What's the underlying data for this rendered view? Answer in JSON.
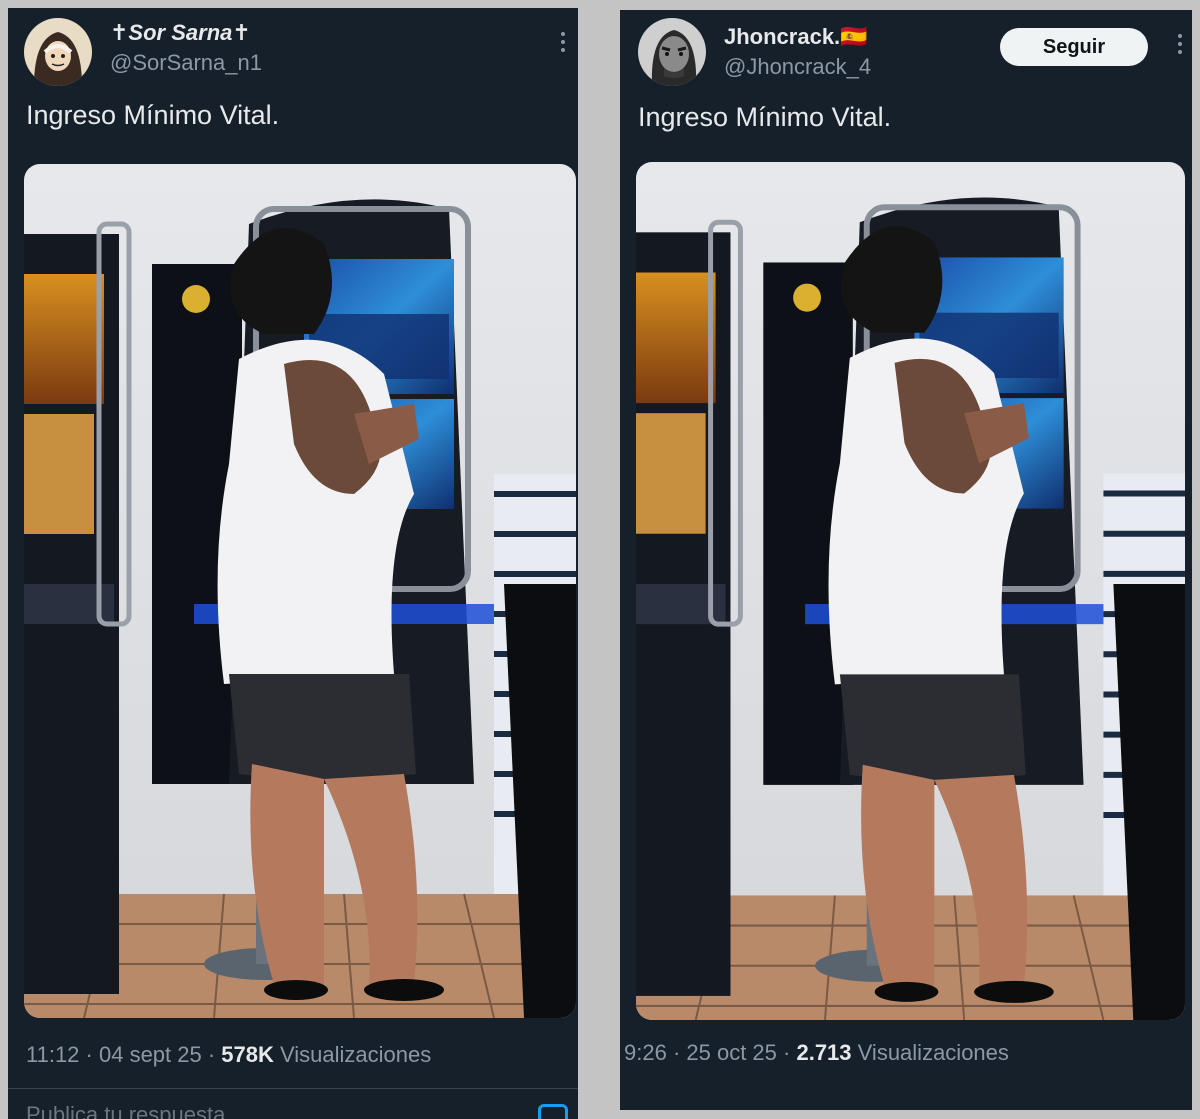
{
  "posts": [
    {
      "display_name": "✝Sor Sarna✝",
      "handle": "@SorSarna_n1",
      "text": "Ingreso Mínimo Vital.",
      "time": "11:12",
      "date": "04 sept 25",
      "views": "578K",
      "views_label": "Visualizaciones",
      "reply_placeholder": "Publica tu respuesta",
      "avatar_icon": "nun-avatar-icon"
    },
    {
      "display_name": "Jhoncrack.🇪🇸",
      "handle": "@Jhoncrack_4",
      "follow_label": "Seguir",
      "text": "Ingreso Mínimo Vital.",
      "time": "9:26",
      "date": "25 oct 25",
      "views": "2.713",
      "views_label": "Visualizaciones",
      "avatar_icon": "man-avatar-icon"
    }
  ],
  "colors": {
    "background": "#15202b",
    "text_primary": "#e7e9ea",
    "text_secondary": "#8b98a5",
    "accent": "#1d9bf0",
    "page_background": "#c4c4c4"
  }
}
